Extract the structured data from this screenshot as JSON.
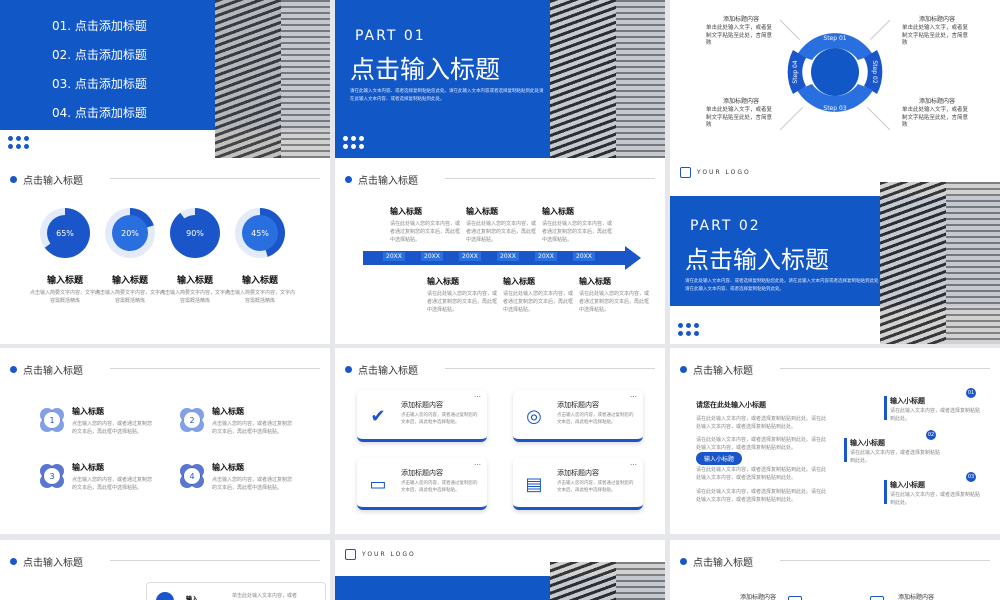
{
  "slide1": {
    "items": [
      "01. 点击添加标题",
      "02. 点击添加标题",
      "03. 点击添加标题",
      "04. 点击添加标题"
    ]
  },
  "slide2": {
    "part": "PART 01",
    "title": "点击输入标题",
    "body": "请在此输入文本内容、或者选择复制粘贴您此处。请在此输入文本内容或者选择复制粘贴到此处请在此输入文本内容、或者选择复制粘贴到此处。"
  },
  "slide3": {
    "steps": [
      "Step 01",
      "Step 02",
      "Step 03",
      "Step 04"
    ],
    "blocks": [
      {
        "title": "添加标题内容",
        "text": "单击此处输入文字，或者复制文字粘贴至此处，言简意赅"
      },
      {
        "title": "添加标题内容",
        "text": "单击此处输入文字，或者复制文字粘贴至此处，言简意赅"
      },
      {
        "title": "添加标题内容",
        "text": "单击此处输入文字，或者复制文字粘贴至此处，言简意赅"
      },
      {
        "title": "添加标题内容",
        "text": "单击此处输入文字，或者复制文字粘贴至此处，言简意赅"
      }
    ]
  },
  "slide4": {
    "header": "点击输入标题",
    "items": [
      {
        "pct": "65%",
        "value": 0.65,
        "title": "输入标题",
        "text": "点击输入简要文字内容，文字内容需概括精炼"
      },
      {
        "pct": "20%",
        "value": 0.2,
        "title": "输入标题",
        "text": "点击输入简要文字内容，文字内容需概括精炼"
      },
      {
        "pct": "90%",
        "value": 0.9,
        "title": "输入标题",
        "text": "点击输入简要文字内容，文字内容需概括精炼"
      },
      {
        "pct": "45%",
        "value": 0.45,
        "title": "输入标题",
        "text": "点击输入简要文字内容，文字内容需概括精炼"
      }
    ]
  },
  "slide5": {
    "header": "点击输入标题",
    "years": [
      "20XX",
      "20XX",
      "20XX",
      "20XX",
      "20XX",
      "20XX"
    ],
    "top": [
      {
        "title": "输入标题",
        "text": "请在此处输入您的文本内容，或者通过复制您的文本后，再此框中选择粘贴。"
      },
      {
        "title": "输入标题",
        "text": "请在此处输入您的文本内容，或者通过复制您的文本后，再此框中选择粘贴。"
      },
      {
        "title": "输入标题",
        "text": "请在此处输入您的文本内容，或者通过复制您的文本后，再此框中选择粘贴。"
      }
    ],
    "bottom": [
      {
        "title": "输入标题",
        "text": "请在此处输入您的文本内容，或者通过复制您的文本后，再此框中选择粘贴。"
      },
      {
        "title": "输入标题",
        "text": "请在此处输入您的文本内容，或者通过复制您的文本后，再此框中选择粘贴。"
      },
      {
        "title": "输入标题",
        "text": "请在此处输入您的文本内容，或者通过复制您的文本后，再此框中选择粘贴。"
      }
    ]
  },
  "slide6": {
    "logo": "YOUR LOGO",
    "part": "PART 02",
    "title": "点击输入标题",
    "body": "请在此处输入文本内容、或者选择复制粘贴您此处。请在此输入文本内容或者选择复制粘贴到此处请在此输入文本内容、或者选择复制粘贴到此处。"
  },
  "slide7": {
    "header": "点击输入标题",
    "items": [
      {
        "num": "1",
        "title": "输入标题",
        "text": "点击输入您的内容，或者通过复制您的文本后，再此框中选择粘贴。"
      },
      {
        "num": "2",
        "title": "输入标题",
        "text": "点击输入您的内容，或者通过复制您的文本后，再此框中选择粘贴。"
      },
      {
        "num": "3",
        "title": "输入标题",
        "text": "点击输入您的内容，或者通过复制您的文本后，再此框中选择粘贴。"
      },
      {
        "num": "4",
        "title": "输入标题",
        "text": "点击输入您的内容，或者通过复制您的文本后，再此框中选择粘贴。"
      }
    ]
  },
  "slide8": {
    "header": "点击输入标题",
    "cards": [
      {
        "title": "添加标题内容",
        "text": "点击输入您的内容，或者通过复制您的文本后，再此框中选择粘贴。",
        "icon": "check-icon"
      },
      {
        "title": "添加标题内容",
        "text": "点击输入您的内容，或者通过复制您的文本后，再此框中选择粘贴。",
        "icon": "coins-icon"
      },
      {
        "title": "添加标题内容",
        "text": "点击输入您的内容，或者通过复制您的文本后，再此框中选择粘贴。",
        "icon": "laptop-icon"
      },
      {
        "title": "添加标题内容",
        "text": "点击输入您的内容，或者通过复制您的文本后，再此框中选择粘贴。",
        "icon": "server-gear-icon"
      }
    ]
  },
  "slide9": {
    "header": "点击输入标题",
    "lead": "请您在此处输入小标题",
    "para": "请在此处输入文本内容，或者选择复制粘贴到此处。请在此处输入文本内容，或者选择复制粘贴到此处。",
    "pill": "输入小标题",
    "items": [
      {
        "n": "01",
        "title": "输入小标题",
        "text": "请在此输入文本内容，或者选择复制粘贴到此处。"
      },
      {
        "n": "02",
        "title": "输入小标题",
        "text": "请在此输入文本内容，或者选择复制粘贴到此处。"
      },
      {
        "n": "03",
        "title": "输入小标题",
        "text": "请在此输入文本内容，或者选择复制粘贴到此处。"
      }
    ]
  },
  "slide10": {
    "header": "点击输入标题",
    "partial": "输入",
    "partial_text": "单击此处输入文本内容，或者"
  },
  "slide11": {
    "logo": "YOUR LOGO"
  },
  "slide12": {
    "header": "点击输入标题",
    "labels": [
      "添加标题内容",
      "添加标题内容"
    ]
  }
}
